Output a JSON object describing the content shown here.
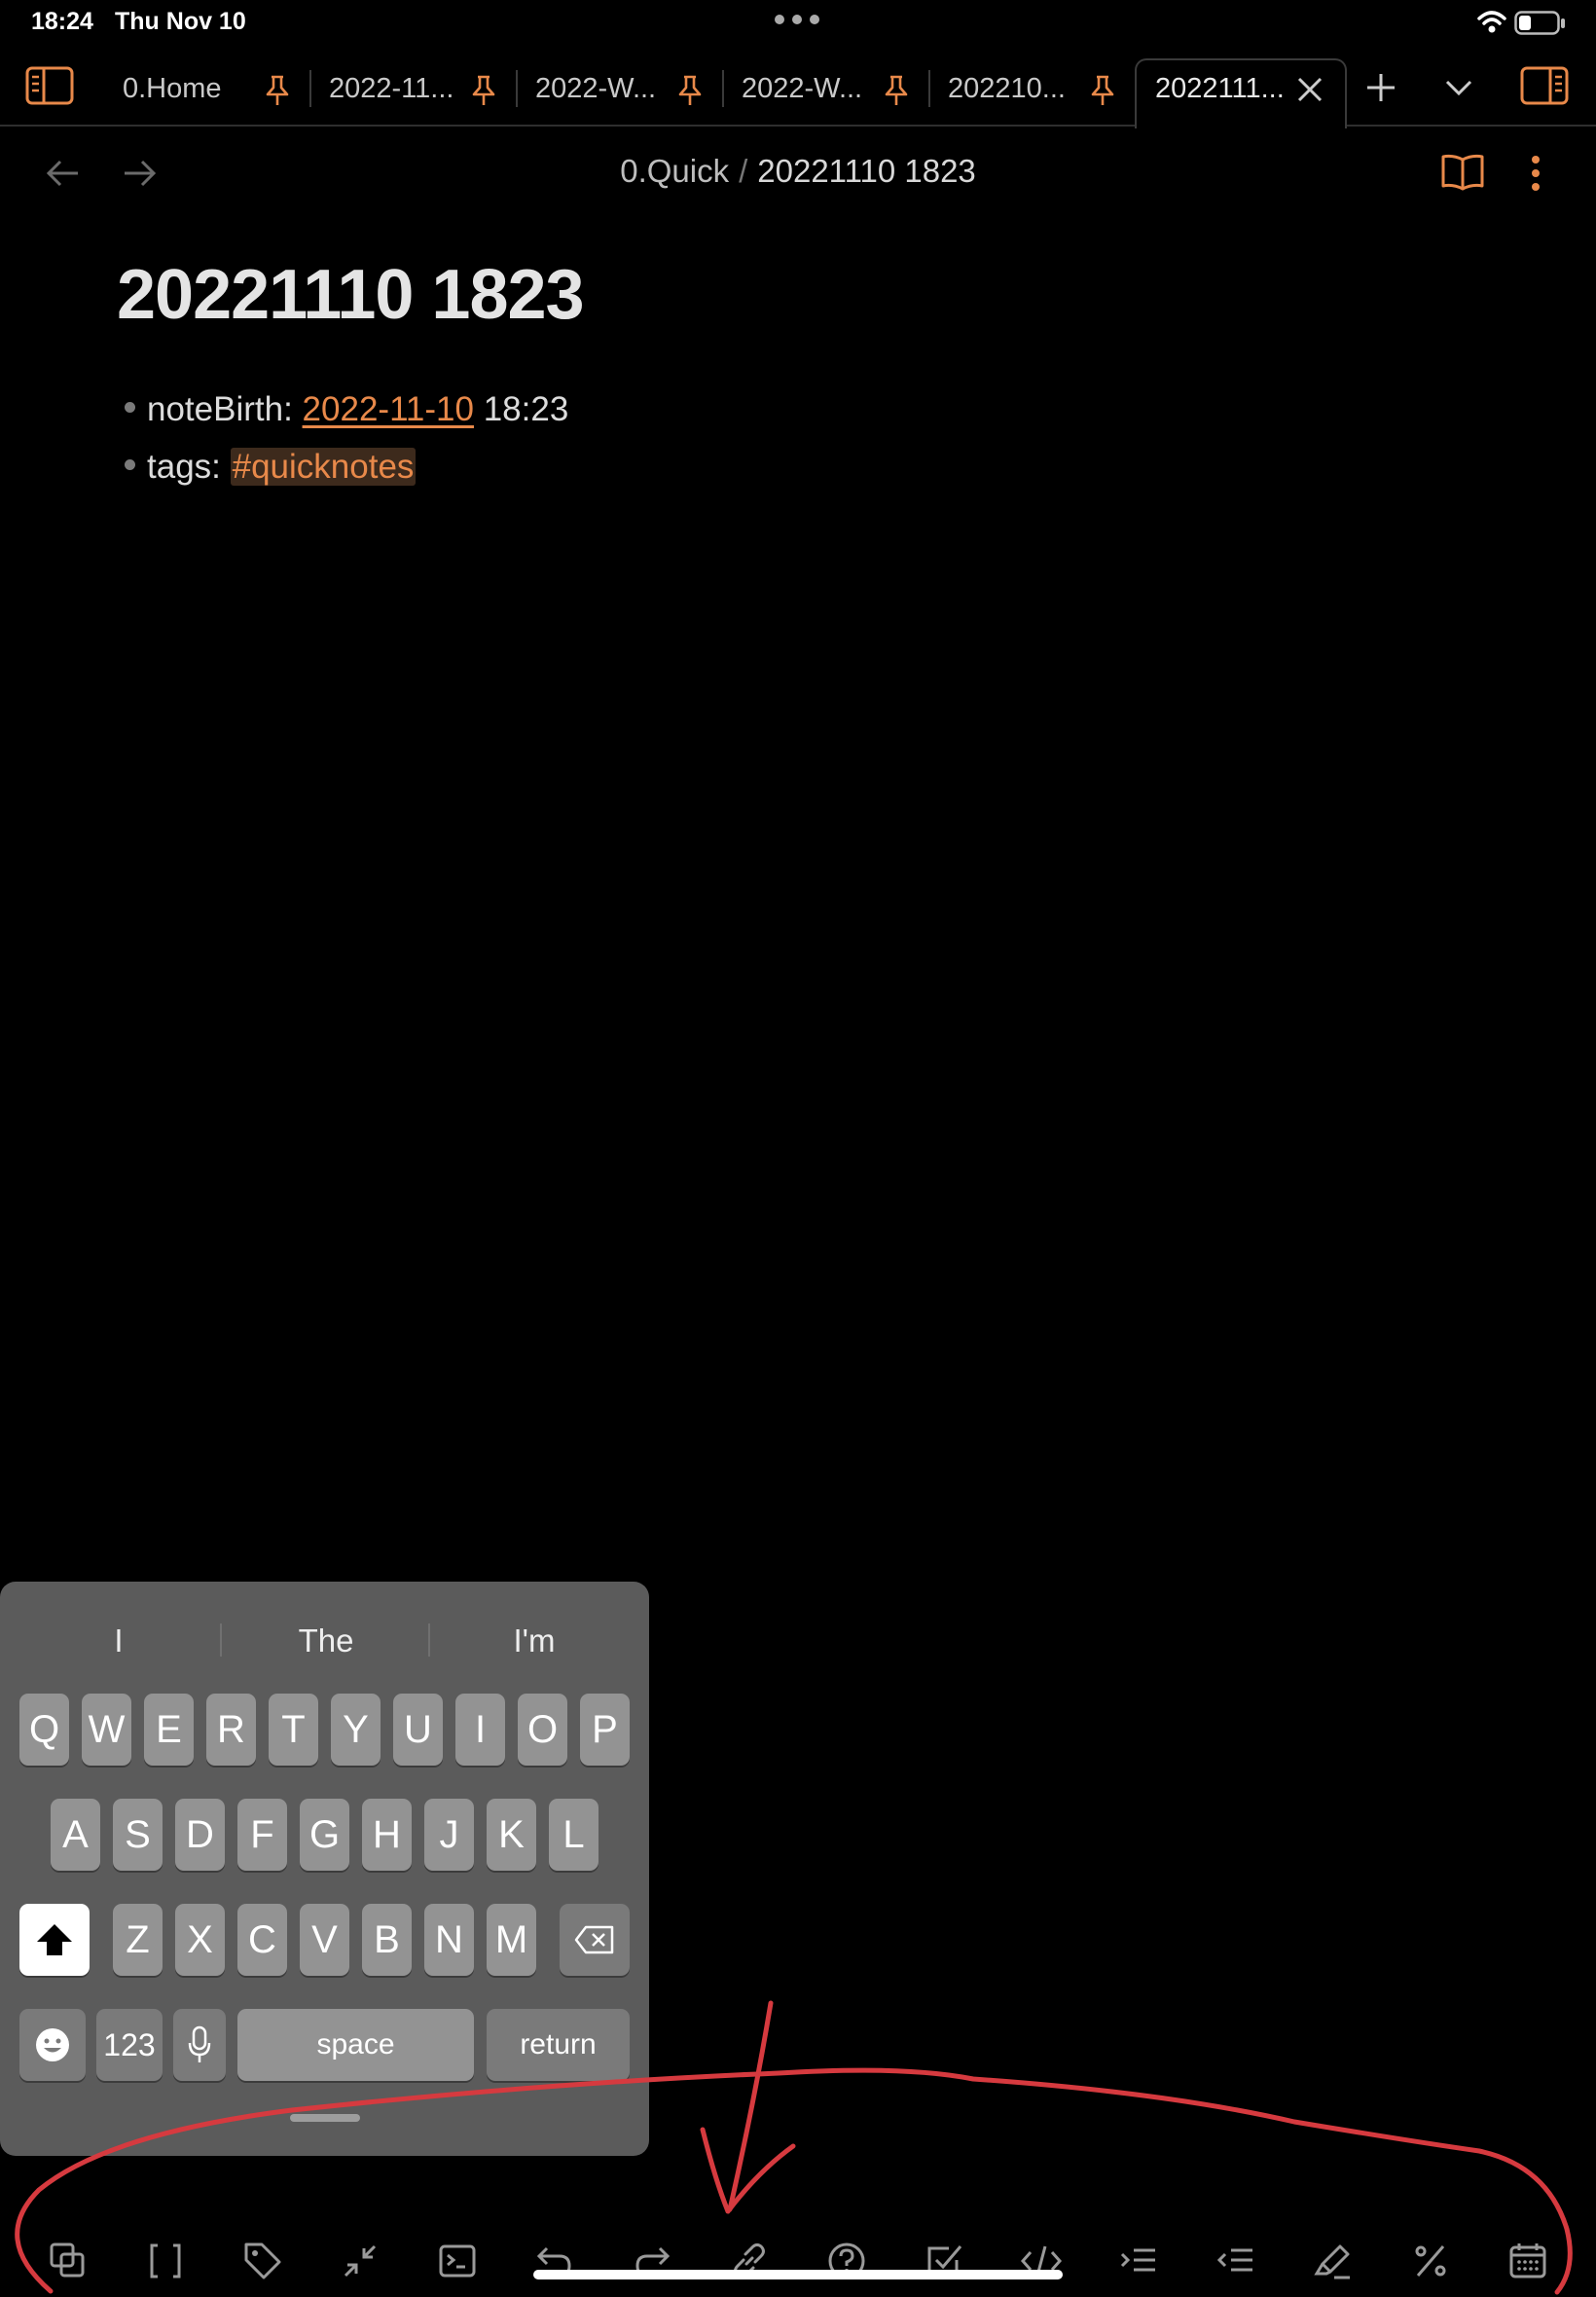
{
  "status_bar": {
    "time": "18:24",
    "date": "Thu Nov 10"
  },
  "tabs": [
    {
      "label": "0.Home",
      "pinned": true
    },
    {
      "label": "2022-11...",
      "pinned": true
    },
    {
      "label": "2022-W...",
      "pinned": true
    },
    {
      "label": "2022-W...",
      "pinned": true
    },
    {
      "label": "202210...",
      "pinned": true
    },
    {
      "label": "2022111...",
      "active": true
    }
  ],
  "breadcrumb": {
    "folder": "0.Quick",
    "separator": "/",
    "note": "20221110 1823"
  },
  "note": {
    "title": "20221110 1823",
    "properties": [
      {
        "key": "noteBirth:",
        "link": "2022-11-10",
        "suffix": "18:23"
      },
      {
        "key": "tags:",
        "tag": "#quicknotes"
      }
    ]
  },
  "keyboard": {
    "suggestions": [
      "I",
      "The",
      "I'm"
    ],
    "row1": [
      "Q",
      "W",
      "E",
      "R",
      "T",
      "Y",
      "U",
      "I",
      "O",
      "P"
    ],
    "row2": [
      "A",
      "S",
      "D",
      "F",
      "G",
      "H",
      "J",
      "K",
      "L"
    ],
    "row3": [
      "Z",
      "X",
      "C",
      "V",
      "B",
      "N",
      "M"
    ],
    "numbers_label": "123",
    "space_label": "space",
    "return_label": "return"
  },
  "toolbar_icons": [
    "copy-icon",
    "brackets-icon",
    "tag-icon",
    "collapse-icon",
    "terminal-icon",
    "undo-icon",
    "redo-icon",
    "link-icon",
    "help-icon",
    "checkbox-icon",
    "code-icon",
    "indent-icon",
    "outdent-icon",
    "highlighter-icon",
    "percent-icon",
    "calendar-icon"
  ],
  "colors": {
    "accent": "#e8894a",
    "background": "#000000",
    "annotation": "#d63a3f"
  }
}
